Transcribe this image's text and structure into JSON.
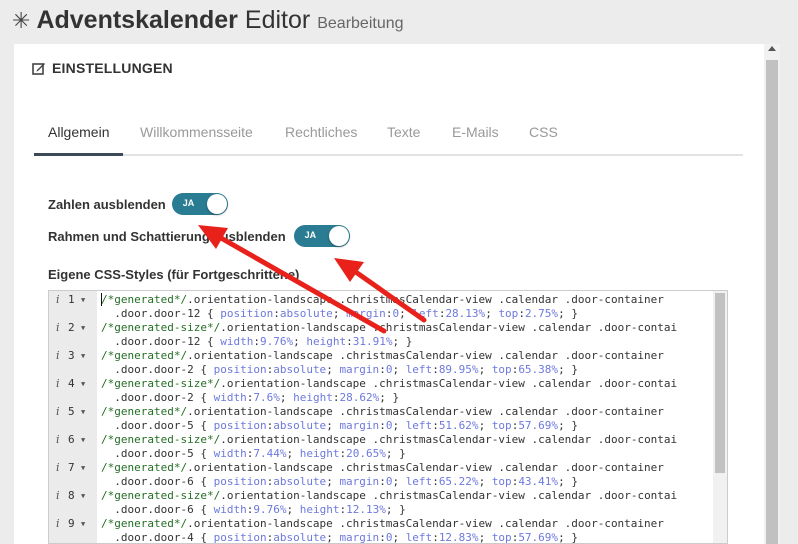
{
  "header": {
    "icon": "sun-icon",
    "title_bold": "Adventskalender",
    "title_regular": "Editor",
    "subtitle": "Bearbeitung"
  },
  "panel": {
    "title_icon": "edit-icon",
    "title": "EINSTELLUNGEN"
  },
  "tabs": [
    {
      "label": "Allgemein",
      "active": true
    },
    {
      "label": "Willkommensseite",
      "active": false
    },
    {
      "label": "Rechtliches",
      "active": false
    },
    {
      "label": "Texte",
      "active": false
    },
    {
      "label": "E-Mails",
      "active": false
    },
    {
      "label": "CSS",
      "active": false
    }
  ],
  "settings": {
    "hide_numbers": {
      "label": "Zahlen ausblenden",
      "toggle_text": "JA",
      "on": true
    },
    "hide_frames": {
      "label": "Rahmen und Schattierung ausblenden",
      "toggle_text": "JA",
      "on": true
    },
    "css_label": "Eigene CSS-Styles (für Fortgeschrittene)"
  },
  "editor": {
    "lines": [
      {
        "num": "1",
        "a": "/*generated*/",
        "b": ".orientation-landscape .christmasCalendar-view .calendar .door-container",
        "c": ".door.door-12 { ",
        "props": [
          [
            "position",
            "absolute"
          ],
          [
            "margin",
            "0"
          ],
          [
            "left",
            "28.13%"
          ],
          [
            "top",
            "2.75%"
          ]
        ]
      },
      {
        "num": "2",
        "a": "/*generated-size*/",
        "b": ".orientation-landscape .christmasCalendar-view .calendar .door-contai",
        "c": ".door.door-12 { ",
        "props": [
          [
            "width",
            "9.76%"
          ],
          [
            "height",
            "31.91%"
          ]
        ]
      },
      {
        "num": "3",
        "a": "/*generated*/",
        "b": ".orientation-landscape .christmasCalendar-view .calendar .door-container",
        "c": ".door.door-2 { ",
        "props": [
          [
            "position",
            "absolute"
          ],
          [
            "margin",
            "0"
          ],
          [
            "left",
            "89.95%"
          ],
          [
            "top",
            "65.38%"
          ]
        ]
      },
      {
        "num": "4",
        "a": "/*generated-size*/",
        "b": ".orientation-landscape .christmasCalendar-view .calendar .door-contai",
        "c": ".door.door-2 { ",
        "props": [
          [
            "width",
            "7.6%"
          ],
          [
            "height",
            "28.62%"
          ]
        ]
      },
      {
        "num": "5",
        "a": "/*generated*/",
        "b": ".orientation-landscape .christmasCalendar-view .calendar .door-container",
        "c": ".door.door-5 { ",
        "props": [
          [
            "position",
            "absolute"
          ],
          [
            "margin",
            "0"
          ],
          [
            "left",
            "51.62%"
          ],
          [
            "top",
            "57.69%"
          ]
        ]
      },
      {
        "num": "6",
        "a": "/*generated-size*/",
        "b": ".orientation-landscape .christmasCalendar-view .calendar .door-contai",
        "c": ".door.door-5 { ",
        "props": [
          [
            "width",
            "7.44%"
          ],
          [
            "height",
            "20.65%"
          ]
        ]
      },
      {
        "num": "7",
        "a": "/*generated*/",
        "b": ".orientation-landscape .christmasCalendar-view .calendar .door-container",
        "c": ".door.door-6 { ",
        "props": [
          [
            "position",
            "absolute"
          ],
          [
            "margin",
            "0"
          ],
          [
            "left",
            "65.22%"
          ],
          [
            "top",
            "43.41%"
          ]
        ]
      },
      {
        "num": "8",
        "a": "/*generated-size*/",
        "b": ".orientation-landscape .christmasCalendar-view .calendar .door-contai",
        "c": ".door.door-6 { ",
        "props": [
          [
            "width",
            "9.76%"
          ],
          [
            "height",
            "12.13%"
          ]
        ]
      },
      {
        "num": "9",
        "a": "/*generated*/",
        "b": ".orientation-landscape .christmasCalendar-view .calendar .door-container",
        "c": ".door.door-4 { ",
        "props": [
          [
            "position",
            "absolute"
          ],
          [
            "margin",
            "0"
          ],
          [
            "left",
            "12.83%"
          ],
          [
            "top",
            "57.69%"
          ]
        ]
      }
    ]
  },
  "colors": {
    "accent_toggle": "#2a7c93",
    "active_tab_underline": "#3c4a57",
    "arrow": "#e8221b"
  }
}
